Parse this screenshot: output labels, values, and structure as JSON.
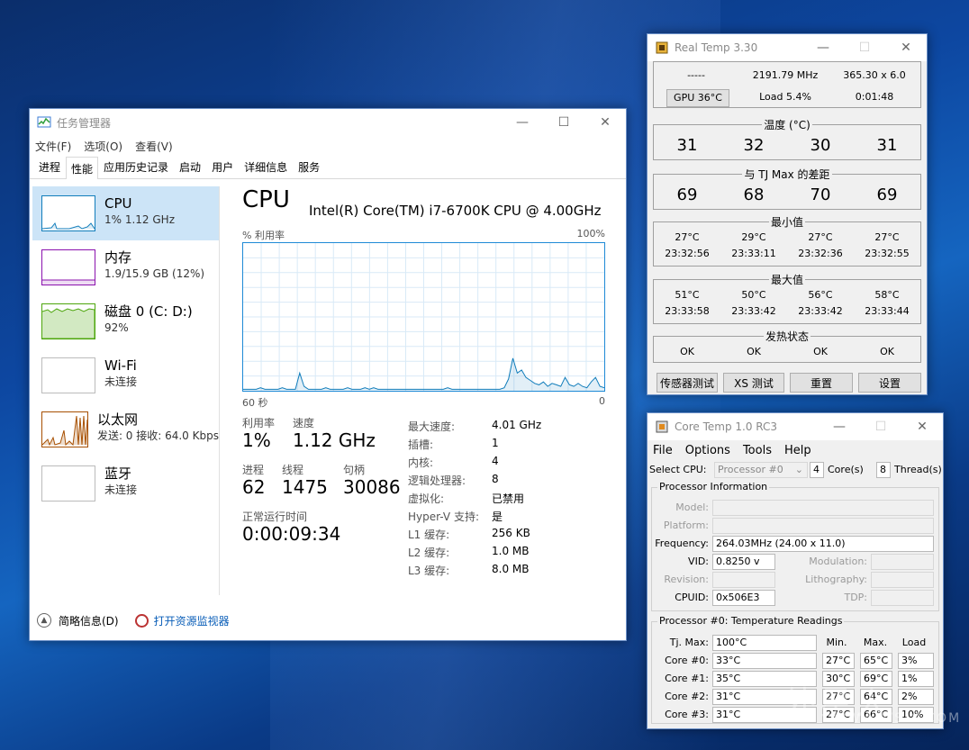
{
  "task_manager": {
    "title": "任务管理器",
    "menu": [
      "文件(F)",
      "选项(O)",
      "查看(V)"
    ],
    "tabs": [
      "进程",
      "性能",
      "应用历史记录",
      "启动",
      "用户",
      "详细信息",
      "服务"
    ],
    "active_tab": "性能",
    "resources": [
      {
        "name": "CPU",
        "sub": "1% 1.12 GHz",
        "color": "#117dbb"
      },
      {
        "name": "内存",
        "sub": "1.9/15.9 GB (12%)",
        "color": "#8b12ae"
      },
      {
        "name": "磁盘 0 (C: D:)",
        "sub": "92%",
        "color": "#4da60c"
      },
      {
        "name": "Wi-Fi",
        "sub": "未连接",
        "color": "#a74f01"
      },
      {
        "name": "以太网",
        "sub": "发送: 0 接收: 64.0 Kbps",
        "color": "#a74f01"
      },
      {
        "name": "蓝牙",
        "sub": "未连接",
        "color": "#a74f01"
      }
    ],
    "cpu": {
      "title": "CPU",
      "model": "Intel(R) Core(TM) i7-6700K CPU @ 4.00GHz",
      "graph_label": "% 利用率",
      "graph_max": "100%",
      "graph_span": "60 秒",
      "graph_min": "0",
      "utilization_label": "利用率",
      "utilization": "1%",
      "speed_label": "速度",
      "speed": "1.12 GHz",
      "processes_label": "进程",
      "processes": "62",
      "threads_label": "线程",
      "threads": "1475",
      "handles_label": "句柄",
      "handles": "30086",
      "uptime_label": "正常运行时间",
      "uptime": "0:00:09:34",
      "details": [
        {
          "k": "最大速度:",
          "v": "4.01 GHz"
        },
        {
          "k": "插槽:",
          "v": "1"
        },
        {
          "k": "内核:",
          "v": "4"
        },
        {
          "k": "逻辑处理器:",
          "v": "8"
        },
        {
          "k": "虚拟化:",
          "v": "已禁用"
        },
        {
          "k": "Hyper-V 支持:",
          "v": "是"
        },
        {
          "k": "L1 缓存:",
          "v": "256 KB"
        },
        {
          "k": "L2 缓存:",
          "v": "1.0 MB"
        },
        {
          "k": "L3 缓存:",
          "v": "8.0 MB"
        }
      ],
      "graph_series": [
        1,
        1,
        1,
        1,
        2,
        1,
        1,
        1,
        1,
        2,
        1,
        1,
        1,
        12,
        3,
        1,
        1,
        1,
        1,
        2,
        1,
        1,
        1,
        1,
        2,
        1,
        1,
        1,
        2,
        1,
        2,
        1,
        1,
        1,
        1,
        1,
        1,
        1,
        1,
        1,
        1,
        1,
        1,
        1,
        1,
        1,
        1,
        2,
        1,
        1,
        1,
        1,
        1,
        1,
        1,
        1,
        1,
        1,
        1,
        1,
        2,
        8,
        22,
        12,
        14,
        9,
        7,
        5,
        4,
        6,
        3,
        5,
        4,
        3,
        9,
        4,
        3,
        5,
        3,
        2,
        6,
        9,
        3,
        2
      ]
    },
    "footer": {
      "less": "简略信息(D)",
      "monitor": "打开资源监视器"
    }
  },
  "real_temp": {
    "title": "Real Temp 3.30",
    "top": {
      "dash": "-----",
      "freq": "2191.79 MHz",
      "mult": "365.30 x 6.0",
      "gpu": "GPU 36°C",
      "load": "Load  5.4%",
      "time": "0:01:48"
    },
    "temp_title": "温度 (°C)",
    "temps": [
      "31",
      "32",
      "30",
      "31"
    ],
    "tj_title": "与 TJ Max 的差距",
    "tj": [
      "69",
      "68",
      "70",
      "69"
    ],
    "min_title": "最小值",
    "min": [
      {
        "t": "27°C",
        "time": "23:32:56"
      },
      {
        "t": "29°C",
        "time": "23:33:11"
      },
      {
        "t": "27°C",
        "time": "23:32:36"
      },
      {
        "t": "27°C",
        "time": "23:32:55"
      }
    ],
    "max_title": "最大值",
    "max": [
      {
        "t": "51°C",
        "time": "23:33:58"
      },
      {
        "t": "50°C",
        "time": "23:33:42"
      },
      {
        "t": "56°C",
        "time": "23:33:42"
      },
      {
        "t": "58°C",
        "time": "23:33:44"
      }
    ],
    "status_title": "发热状态",
    "status": [
      "OK",
      "OK",
      "OK",
      "OK"
    ],
    "buttons": [
      "传感器测试",
      "XS 测试",
      "重置",
      "设置"
    ]
  },
  "core_temp": {
    "title": "Core Temp 1.0 RC3",
    "menu": [
      "File",
      "Options",
      "Tools",
      "Help"
    ],
    "select_cpu_label": "Select CPU:",
    "processor": "Processor #0",
    "cores": "4",
    "cores_label": "Core(s)",
    "threads": "8",
    "threads_label": "Thread(s)",
    "info_title": "Processor Information",
    "model_label": "Model:",
    "platform_label": "Platform:",
    "frequency_label": "Frequency:",
    "frequency": "264.03MHz (24.00 x 11.0)",
    "vid_label": "VID:",
    "vid": "0.8250 v",
    "modulation_label": "Modulation:",
    "revision_label": "Revision:",
    "lithography_label": "Lithography:",
    "cpuid_label": "CPUID:",
    "cpuid": "0x506E3",
    "tdp_label": "TDP:",
    "readings_title": "Processor #0: Temperature Readings",
    "tjmax_label": "Tj. Max:",
    "tjmax": "100°C",
    "col_min": "Min.",
    "col_max": "Max.",
    "col_load": "Load",
    "cores_rows": [
      {
        "label": "Core #0:",
        "temp": "33°C",
        "min": "27°C",
        "max": "65°C",
        "load": "3%"
      },
      {
        "label": "Core #1:",
        "temp": "35°C",
        "min": "30°C",
        "max": "69°C",
        "load": "1%"
      },
      {
        "label": "Core #2:",
        "temp": "31°C",
        "min": "27°C",
        "max": "64°C",
        "load": "2%"
      },
      {
        "label": "Core #3:",
        "temp": "31°C",
        "min": "27°C",
        "max": "66°C",
        "load": "10%"
      }
    ]
  },
  "watermark": {
    "main": "外星人",
    "sub": "WWW.WSIX.COM"
  }
}
